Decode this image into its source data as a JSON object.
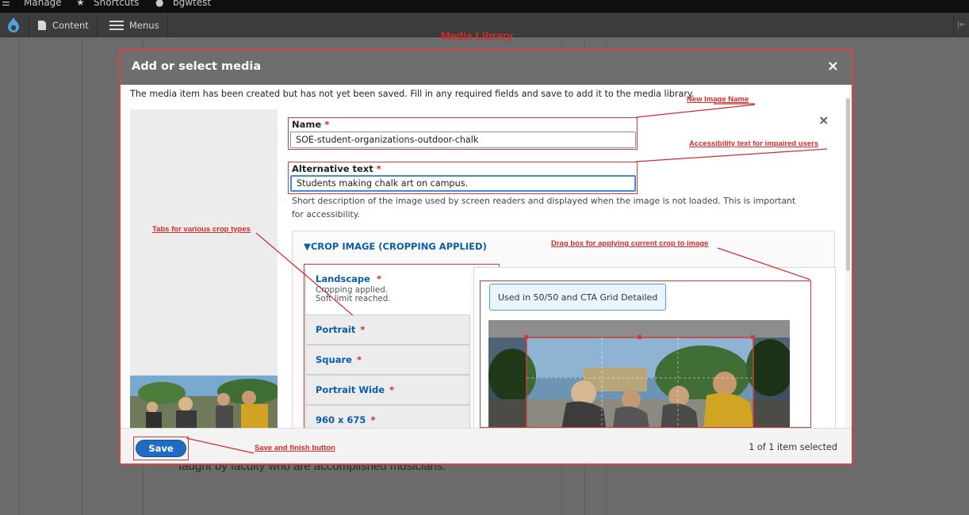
{
  "topbar": {
    "items": [
      "Manage",
      "Shortcuts",
      "bgwtest"
    ]
  },
  "toolbar": {
    "content_label": "Content",
    "menus_label": "Menus"
  },
  "page": {
    "media_library_title": "Media Library",
    "background_text": "taught by faculty who are accomplished musicians."
  },
  "dialog": {
    "title": "Add or select media",
    "close_glyph": "×",
    "note": "The media item has been created but has not yet been saved. Fill in any required fields and save to add it to the media library.",
    "remove_glyph": "×",
    "name_label": "Name",
    "name_value": "SOE-student-organizations-outdoor-chalk",
    "alt_label": "Alternative text",
    "alt_value": "Students making chalk art on campus.",
    "alt_description": "Short description of the image used by screen readers and displayed when the image is not loaded. This is important for accessibility.",
    "required_marker": "*",
    "crop": {
      "summary": "▼CROP IMAGE (CROPPING APPLIED)",
      "tabs": [
        {
          "label": "Landscape",
          "status1": "Cropping applied.",
          "status2": "Soft limit reached."
        },
        {
          "label": "Portrait"
        },
        {
          "label": "Square"
        },
        {
          "label": "Portrait Wide"
        },
        {
          "label": "960 x 675"
        }
      ],
      "used_badge": "Used in 50/50 and CTA Grid Detailed"
    },
    "footer": {
      "save_label": "Save",
      "selection_count": "1 of 1 item selected"
    }
  },
  "annotations": {
    "new_image_name": "New Image Name",
    "accessibility_text": "Accessibility text for impaired users",
    "tabs_crop_types": "Tabs for various crop types",
    "drag_box": "Drag box for applying current crop to image",
    "save_finish": "Save and finish button"
  },
  "colors": {
    "annotation_red": "#d42a2a",
    "link_blue": "#0b5da8",
    "save_blue": "#1f6cc2"
  }
}
